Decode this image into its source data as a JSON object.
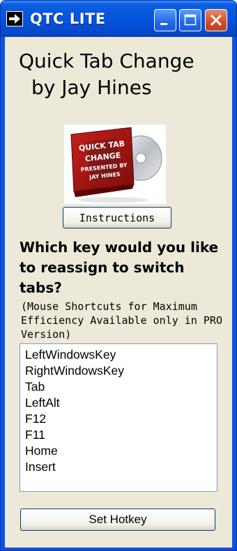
{
  "window": {
    "title": "QTC LITE",
    "controls": {
      "minimize": "minimize-icon",
      "maximize": "maximize-icon",
      "close": "close-icon"
    }
  },
  "header": {
    "line1": "Quick Tab Change",
    "line2": "by Jay Hines"
  },
  "product_image": {
    "label_lines": [
      "QUICK TAB",
      "CHANGE",
      "PRESENTED BY",
      "JAY HINES"
    ]
  },
  "buttons": {
    "instructions": "Instructions",
    "set_hotkey": "Set Hotkey"
  },
  "question": "Which key would you like to reassign to switch tabs?",
  "note": "(Mouse Shortcuts for Maximum Efficiency Available only in PRO Version)",
  "keys": [
    "LeftWindowsKey",
    "RightWindowsKey",
    "Tab",
    "LeftAlt",
    "F12",
    "F11",
    "Home",
    "Insert"
  ],
  "colors": {
    "titlebar": "#0a54e4",
    "client_bg": "#ece9d8",
    "close_button": "#d3502b",
    "listbox_border": "#7f9db9"
  }
}
